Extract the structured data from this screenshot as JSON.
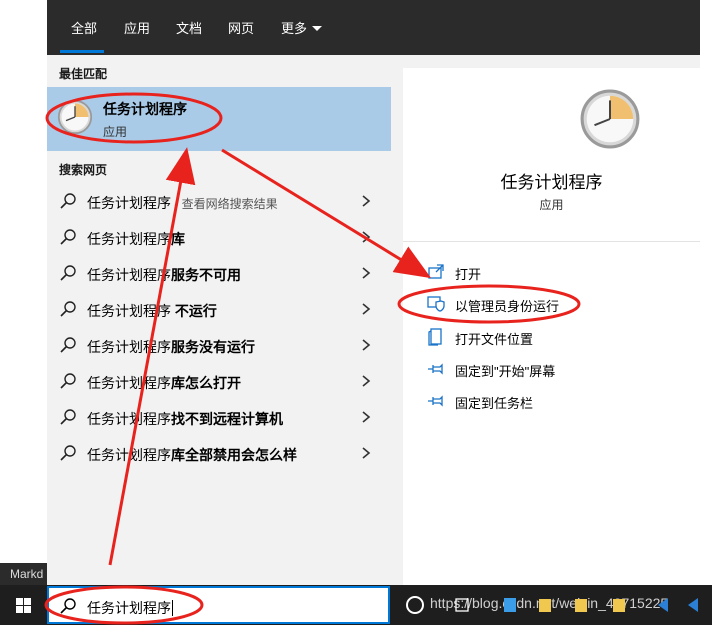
{
  "desktop": {
    "left_tab_text": "Markd"
  },
  "tabs": [
    {
      "label": "全部"
    },
    {
      "label": "应用"
    },
    {
      "label": "文档"
    },
    {
      "label": "网页"
    },
    {
      "label": "更多"
    }
  ],
  "best_match": {
    "section_title": "最佳匹配",
    "name": "任务计划程序",
    "type": "应用"
  },
  "web": {
    "section_title": "搜索网页",
    "items": [
      {
        "prefix": "任务计划程序",
        "suffix": "",
        "hint": " - 查看网络搜索结果"
      },
      {
        "prefix": "任务计划程序",
        "suffix": "库",
        "hint": ""
      },
      {
        "prefix": "任务计划程序",
        "suffix": "服务不可用",
        "hint": ""
      },
      {
        "prefix": "任务计划程序",
        "suffix": " 不运行",
        "hint": ""
      },
      {
        "prefix": "任务计划程序",
        "suffix": "服务没有运行",
        "hint": ""
      },
      {
        "prefix": "任务计划程序",
        "suffix": "库怎么打开",
        "hint": ""
      },
      {
        "prefix": "任务计划程序",
        "suffix": "找不到远程计算机",
        "hint": ""
      },
      {
        "prefix": "任务计划程序",
        "suffix": "库全部禁用会怎么样",
        "hint": ""
      }
    ]
  },
  "details": {
    "title": "任务计划程序",
    "type": "应用",
    "actions": [
      {
        "label": "打开",
        "icon": "open-icon"
      },
      {
        "label": "以管理员身份运行",
        "icon": "shield-icon"
      },
      {
        "label": "打开文件位置",
        "icon": "file-location-icon"
      },
      {
        "label": "固定到\"开始\"屏幕",
        "icon": "pin-icon"
      },
      {
        "label": "固定到任务栏",
        "icon": "pin-icon"
      }
    ]
  },
  "taskbar": {
    "search_value": "任务计划程序",
    "watermark": "https://blog.csdn.net/weixin_42715225"
  },
  "colors": {
    "accent": "#0078d7",
    "highlight": "#a9cbe8",
    "annotation": "#e8231e"
  }
}
